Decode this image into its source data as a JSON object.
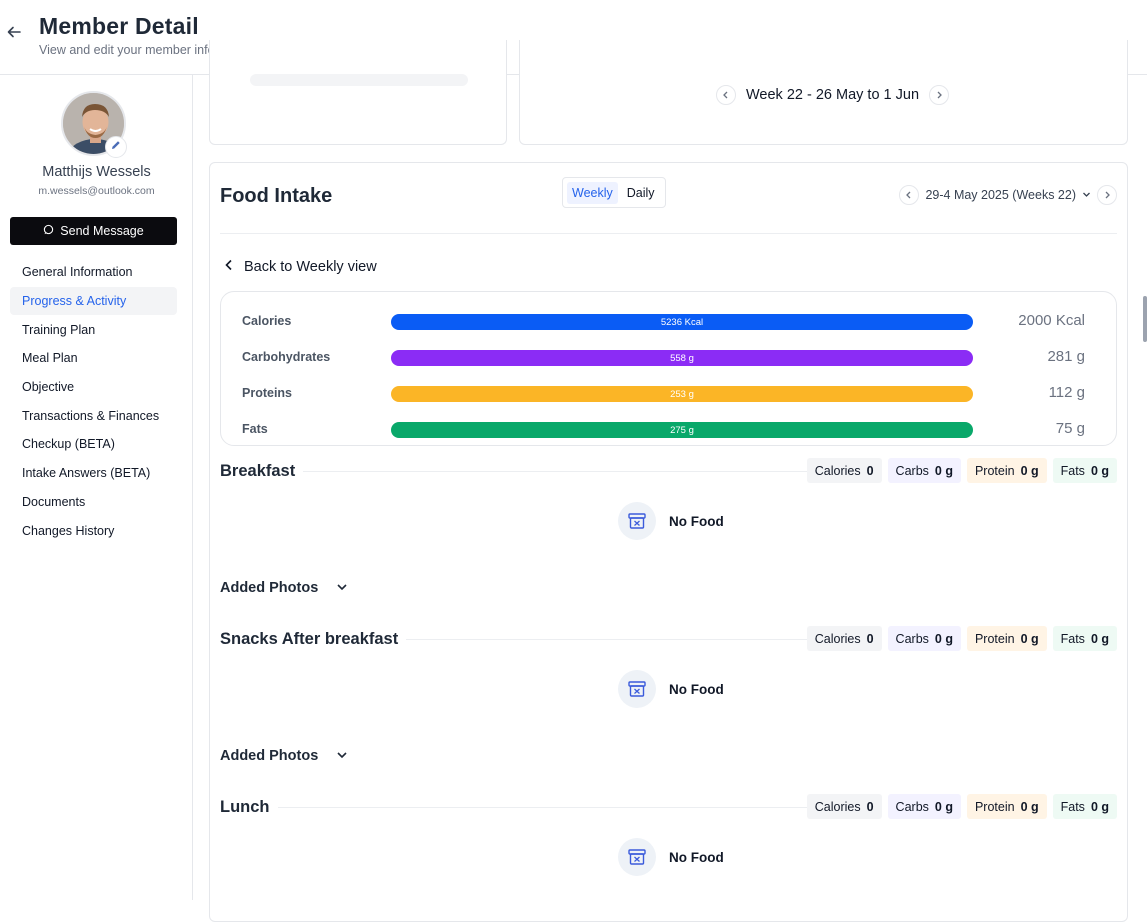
{
  "header": {
    "title": "Member Detail",
    "subtitle": "View and edit your member information"
  },
  "member": {
    "name": "Matthijs Wessels",
    "email": "m.wessels@outlook.com",
    "send_message": "Send Message"
  },
  "nav": {
    "items": [
      {
        "label": "General Information"
      },
      {
        "label": "Progress & Activity",
        "active": true
      },
      {
        "label": "Training Plan"
      },
      {
        "label": "Meal Plan"
      },
      {
        "label": "Objective"
      },
      {
        "label": "Transactions & Finances"
      },
      {
        "label": "Checkup (BETA)"
      },
      {
        "label": "Intake Answers (BETA)"
      },
      {
        "label": "Documents"
      },
      {
        "label": "Changes History"
      }
    ]
  },
  "week_nav": {
    "label": "Week 22 - 26 May to 1 Jun"
  },
  "food_intake": {
    "title": "Food Intake",
    "toggle": {
      "weekly": "Weekly",
      "daily": "Daily",
      "selected": "Weekly"
    },
    "range_label": "29-4 May 2025 (Weeks 22)",
    "back_label": "Back to Weekly view",
    "summary": [
      {
        "label": "Calories",
        "value": "5236 Kcal",
        "target": "2000 Kcal",
        "color": "#0a5cf5"
      },
      {
        "label": "Carbohydrates",
        "value": "558 g",
        "target": "281 g",
        "color": "#8b2cf5"
      },
      {
        "label": "Proteins",
        "value": "253 g",
        "target": "112 g",
        "color": "#fbb526"
      },
      {
        "label": "Fats",
        "value": "275 g",
        "target": "75 g",
        "color": "#09a86a"
      }
    ],
    "chip_labels": {
      "calories": "Calories",
      "carbs": "Carbs",
      "protein": "Protein",
      "fats": "Fats"
    },
    "meals": [
      {
        "title": "Breakfast",
        "calories": "0",
        "carbs": "0 g",
        "protein": "0 g",
        "fats": "0 g",
        "empty": "No Food",
        "photos": "Added Photos"
      },
      {
        "title": "Snacks After breakfast",
        "calories": "0",
        "carbs": "0 g",
        "protein": "0 g",
        "fats": "0 g",
        "empty": "No Food",
        "photos": "Added Photos"
      },
      {
        "title": "Lunch",
        "calories": "0",
        "carbs": "0 g",
        "protein": "0 g",
        "fats": "0 g",
        "empty": "No Food",
        "photos": "Added Photos"
      }
    ]
  },
  "icons": [
    "back-arrow-icon",
    "pencil-icon",
    "message-icon",
    "chevron-left-icon",
    "chevron-right-icon",
    "chevron-down-icon",
    "archive-box-icon"
  ]
}
